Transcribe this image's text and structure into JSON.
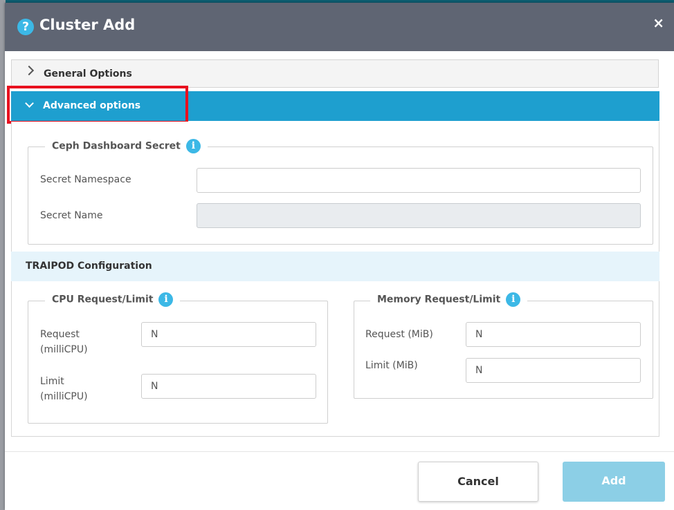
{
  "modal": {
    "title": "Cluster Add",
    "close_label": "×",
    "help_label": "?"
  },
  "accordion": {
    "general_label": "General Options",
    "advanced_label": "Advanced options"
  },
  "ceph": {
    "legend": "Ceph Dashboard Secret",
    "info_label": "i",
    "namespace_label": "Secret Namespace",
    "namespace_value": "",
    "name_label": "Secret Name",
    "name_value": ""
  },
  "traipod": {
    "title": "TRAIPOD Configuration"
  },
  "cpu": {
    "legend": "CPU Request/Limit",
    "info_label": "i",
    "request_label_line1": "Request",
    "request_label_line2": "(milliCPU)",
    "request_placeholder": "N",
    "limit_label_line1": "Limit",
    "limit_label_line2": "(milliCPU)",
    "limit_placeholder": "N"
  },
  "memory": {
    "legend": "Memory Request/Limit",
    "info_label": "i",
    "request_label": "Request (MiB)",
    "request_placeholder": "N",
    "limit_label": "Limit (MiB)",
    "limit_placeholder": "N"
  },
  "footer": {
    "cancel_label": "Cancel",
    "add_label": "Add"
  },
  "colors": {
    "header_bg": "#5f6573",
    "accent": "#1e9fcf",
    "highlight": "#e8101f",
    "add_button_disabled": "#8ccfe6"
  }
}
